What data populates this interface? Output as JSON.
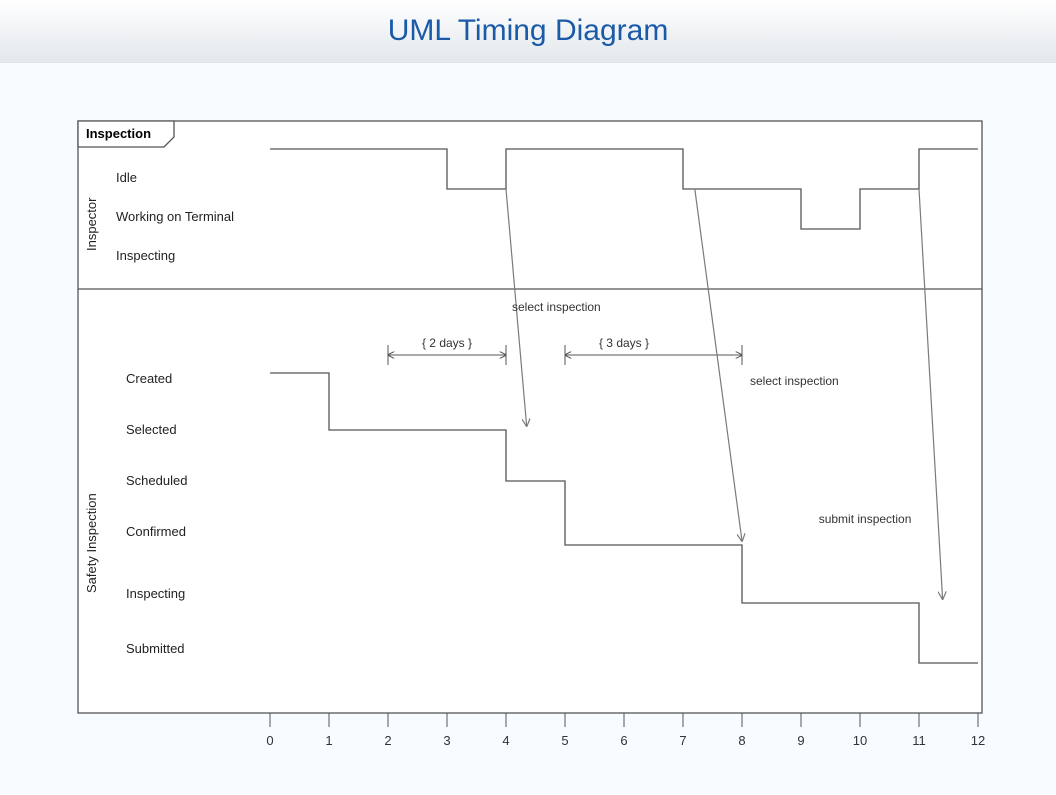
{
  "title": "UML Timing Diagram",
  "frame_label": "Inspection",
  "lanes": {
    "top": {
      "name": "Inspector",
      "states": [
        "Idle",
        "Working on Terminal",
        "Inspecting"
      ]
    },
    "bottom": {
      "name": "Safety Inspection",
      "states": [
        "Created",
        "Selected",
        "Scheduled",
        "Confirmed",
        "Inspecting",
        "Submitted"
      ]
    }
  },
  "axis": {
    "ticks": [
      "0",
      "1",
      "2",
      "3",
      "4",
      "5",
      "6",
      "7",
      "8",
      "9",
      "10",
      "11",
      "12"
    ]
  },
  "constraints": {
    "c1": "{ 2 days }",
    "c2": "{ 3 days }"
  },
  "messages": {
    "m1": "select inspection",
    "m2": "select inspection",
    "m3": "submit inspection"
  },
  "chart_data": {
    "type": "timing",
    "x_range": [
      0,
      12
    ],
    "lifelines": [
      {
        "name": "Inspector",
        "states_order": [
          "Idle",
          "Working on Terminal",
          "Inspecting"
        ],
        "segments": [
          {
            "state": "Idle",
            "from": 0,
            "to": 3
          },
          {
            "state": "Working on Terminal",
            "from": 3,
            "to": 4
          },
          {
            "state": "Idle",
            "from": 4,
            "to": 7
          },
          {
            "state": "Working on Terminal",
            "from": 7,
            "to": 9
          },
          {
            "state": "Inspecting",
            "from": 9,
            "to": 10
          },
          {
            "state": "Working on Terminal",
            "from": 10,
            "to": 11
          },
          {
            "state": "Idle",
            "from": 11,
            "to": 12
          }
        ]
      },
      {
        "name": "Safety Inspection",
        "states_order": [
          "Created",
          "Selected",
          "Scheduled",
          "Confirmed",
          "Inspecting",
          "Submitted"
        ],
        "segments": [
          {
            "state": "Created",
            "from": 0,
            "to": 1
          },
          {
            "state": "Selected",
            "from": 1,
            "to": 4
          },
          {
            "state": "Scheduled",
            "from": 4,
            "to": 5
          },
          {
            "state": "Confirmed",
            "from": 5,
            "to": 8
          },
          {
            "state": "Inspecting",
            "from": 8,
            "to": 11
          },
          {
            "state": "Submitted",
            "from": 11,
            "to": 12
          }
        ]
      }
    ],
    "constraints": [
      {
        "label": "{ 2 days }",
        "from": 2,
        "to": 4
      },
      {
        "label": "{ 3 days }",
        "from": 5,
        "to": 8
      }
    ],
    "messages": [
      {
        "label": "select inspection",
        "from_lifeline": "Inspector",
        "from_time": 4,
        "to_lifeline": "Safety Inspection",
        "to_time": 4.3,
        "to_state": "Selected"
      },
      {
        "label": "select inspection",
        "from_lifeline": "Inspector",
        "from_time": 7.2,
        "to_lifeline": "Safety Inspection",
        "to_time": 8,
        "to_state": "Confirmed"
      },
      {
        "label": "submit inspection",
        "from_lifeline": "Inspector",
        "from_time": 11,
        "to_lifeline": "Safety Inspection",
        "to_time": 11.4,
        "to_state": "Inspecting"
      }
    ]
  }
}
